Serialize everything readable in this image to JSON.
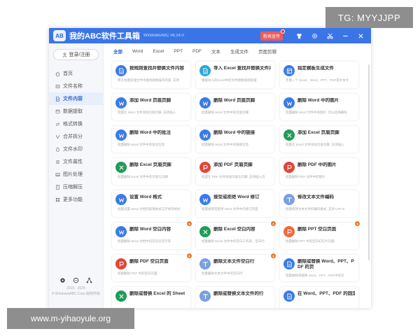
{
  "window": {
    "logo_text": "AB",
    "title": "我的ABC软件工具箱",
    "version": "WindowsABC v6.14.0",
    "notification_label": "粉表宣传",
    "accent": "#3a75e8",
    "titlebar_icons": [
      "shirt-icon",
      "gear-icon",
      "scissors-icon",
      "minimize-icon",
      "close-icon"
    ]
  },
  "sidebar": {
    "login_label": "登录/注册",
    "items": [
      {
        "label": "首页",
        "icon": "home-icon"
      },
      {
        "label": "文件名称",
        "icon": "rename-icon"
      },
      {
        "label": "文件内容",
        "icon": "file-content-icon",
        "active": true
      },
      {
        "label": "数据提取",
        "icon": "data-icon"
      },
      {
        "label": "格式转换",
        "icon": "convert-icon"
      },
      {
        "label": "合并拆分",
        "icon": "merge-icon"
      },
      {
        "label": "文件水印",
        "icon": "watermark-icon"
      },
      {
        "label": "文件属性",
        "icon": "properties-icon"
      },
      {
        "label": "图片处理",
        "icon": "image-icon"
      },
      {
        "label": "压缩解压",
        "icon": "compress-icon"
      },
      {
        "label": "更多功能",
        "icon": "more-icon"
      }
    ],
    "bottom_icons": [
      "settings-gear-icon",
      "chat-icon",
      "share-icon"
    ],
    "copyright_line1": "2015 - 2024",
    "copyright_line2": "© WindowsABC.Corp 版权所有"
  },
  "tabs": [
    "全部",
    "Word",
    "Excel",
    "PPT",
    "PDF",
    "文本",
    "生成文件",
    "页面剪辑"
  ],
  "active_tab": 0,
  "cards": [
    {
      "title": "按规则查找并替换文件内容",
      "desc": "用于批量处理文件中查找替换操作内容, 支持",
      "color": "#3a7be8",
      "icon": "doc-icon",
      "badge": false
    },
    {
      "title": "导入 Excel 查找并替换文件内容",
      "desc": "根据导入的Excel中的文件替换规则处理",
      "color": "#2aa6d8",
      "icon": "doc-icon",
      "badge": false
    },
    {
      "title": "指定模板生成文件",
      "desc": "无需一个 Excel、Word、PPT、PDF或文本文",
      "color": "#3a7be8",
      "icon": "template-icon",
      "badge": false
    },
    {
      "title": "添加 Word 页眉页脚",
      "desc": "批量在 Word 文件添加页眉页脚, 支持插入",
      "color": "#3a7be8",
      "icon": "word-icon",
      "badge": false
    },
    {
      "title": "删除 Word 页眉页脚",
      "desc": "批量删除 Word 文件中的页眉页脚",
      "color": "#3a7be8",
      "icon": "word-icon",
      "badge": false
    },
    {
      "title": "删除 Word 中的图片",
      "desc": "批量删除 Word 文件中的图片, 可以选择删除",
      "color": "#3a7be8",
      "icon": "word-icon",
      "badge": false
    },
    {
      "title": "删除 Word 中的批注",
      "desc": "批量删除 Word 文件中的批注信息",
      "color": "#3a7be8",
      "icon": "word-icon",
      "badge": false
    },
    {
      "title": "删除 Word 中的链接",
      "desc": "批量删除 Word 文件中的链接信息",
      "color": "#3a7be8",
      "icon": "word-icon",
      "badge": false
    },
    {
      "title": "添加 Excel 页眉页脚",
      "desc": "批量在 Excel 文件添加页眉页脚, 支持插入",
      "color": "#1f9c56",
      "icon": "excel-icon",
      "badge": false
    },
    {
      "title": "删除 Excel 页眉页脚",
      "desc": "批量删除 Excel 文件中的页眉与页脚",
      "color": "#1f9c56",
      "icon": "excel-icon",
      "badge": false
    },
    {
      "title": "添加 PDF 页眉页脚",
      "desc": "批量在 PDF 文件添加页眉与页脚, 支持插入页",
      "color": "#e0453a",
      "icon": "pdf-icon",
      "badge": false
    },
    {
      "title": "删除 PDF 中的图片",
      "desc": "批量删除 PDF 文件中的图片",
      "color": "#e0453a",
      "icon": "pdf-icon",
      "badge": false
    },
    {
      "title": "设置 Word 格式",
      "desc": "批量设置 Word 文档的段落格式与字体等格式",
      "color": "#3a7be8",
      "icon": "word-icon",
      "badge": false
    },
    {
      "title": "接受或拒绝 Word 修订",
      "desc": "批量接受或拒绝 Word 文件中的修订内容",
      "color": "#3a7be8",
      "icon": "word-icon",
      "badge": false
    },
    {
      "title": "修改文本文件编码",
      "desc": "批量修改文本文件的编码格式, 支持 UTF-8",
      "color": "#7b9fe0",
      "icon": "text-icon",
      "badge": false
    },
    {
      "title": "删除 Word 空白内容",
      "desc": "批量删除 Word 文档中的空白页空行等",
      "color": "#3a7be8",
      "icon": "word-icon",
      "badge": true
    },
    {
      "title": "删除 Excel 空白内容",
      "desc": "批量删除 Excel 文件中的空白工作表、空白行",
      "color": "#1f9c56",
      "icon": "excel-icon",
      "badge": true
    },
    {
      "title": "删除 PPT 空白页面",
      "desc": "批量删除 PPT 中的空白幻灯片页面",
      "color": "#ee6a3e",
      "icon": "ppt-icon",
      "badge": true
    },
    {
      "title": "删除 PDF 空白页面",
      "desc": "批量删除 PDF 中的空白页面",
      "color": "#e0453a",
      "icon": "pdf-icon",
      "badge": true
    },
    {
      "title": "删除文本文件空白行",
      "desc": "批量删除文本文件中的空白行",
      "color": "#7b9fe0",
      "icon": "text-icon",
      "badge": true
    },
    {
      "title": "删除或替换 Word、PPT、P",
      "title2": "DF 的页",
      "desc": "批量删除或替换 Word、PPT、PDF中的页",
      "color": "#3a7be8",
      "icon": "doc-icon",
      "badge": false
    },
    {
      "title": "删除或替换 Excel 的 Sheet",
      "desc": "",
      "color": "#1f9c56",
      "icon": "excel-icon",
      "badge": false
    },
    {
      "title": "删除或替换文本文件的行",
      "desc": "",
      "color": "#7b9fe0",
      "icon": "text-icon",
      "badge": false
    },
    {
      "title": "在 Word、PPT、PDF 的固定",
      "desc": "",
      "color": "#3a7be8",
      "icon": "doc-icon",
      "badge": false
    }
  ],
  "overlays": {
    "tg": "TG: MYYJJPP",
    "url": "www.m-yihaoyule.org"
  }
}
